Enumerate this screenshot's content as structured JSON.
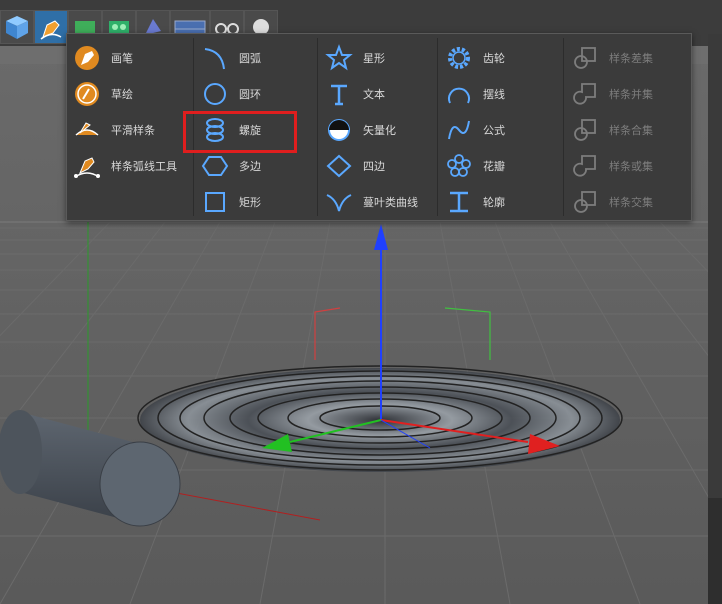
{
  "menu": {
    "col1": [
      {
        "label": "画笔",
        "icon": "pen-icon"
      },
      {
        "label": "草绘",
        "icon": "sketch-icon"
      },
      {
        "label": "平滑样条",
        "icon": "smooth-spline-icon"
      },
      {
        "label": "样条弧线工具",
        "icon": "spline-arc-tool-icon"
      }
    ],
    "col2": [
      {
        "label": "圆弧",
        "icon": "arc-icon"
      },
      {
        "label": "圆环",
        "icon": "circle-icon"
      },
      {
        "label": "螺旋",
        "icon": "helix-icon"
      },
      {
        "label": "多边",
        "icon": "polygon-icon"
      },
      {
        "label": "矩形",
        "icon": "rectangle-icon"
      }
    ],
    "col3": [
      {
        "label": "星形",
        "icon": "star-icon"
      },
      {
        "label": "文本",
        "icon": "text-icon"
      },
      {
        "label": "矢量化",
        "icon": "vectorize-icon"
      },
      {
        "label": "四边",
        "icon": "four-side-icon"
      },
      {
        "label": "蔓叶类曲线",
        "icon": "cissoid-icon"
      }
    ],
    "col4": [
      {
        "label": "齿轮",
        "icon": "gear-icon"
      },
      {
        "label": "摆线",
        "icon": "cycloid-icon"
      },
      {
        "label": "公式",
        "icon": "formula-icon"
      },
      {
        "label": "花瓣",
        "icon": "flower-icon"
      },
      {
        "label": "轮廓",
        "icon": "profile-icon"
      }
    ],
    "col5": [
      {
        "label": "样条差集",
        "icon": "spline-subtract-icon"
      },
      {
        "label": "样条并集",
        "icon": "spline-union-icon"
      },
      {
        "label": "样条合集",
        "icon": "spline-and-icon"
      },
      {
        "label": "样条或集",
        "icon": "spline-or-icon"
      },
      {
        "label": "样条交集",
        "icon": "spline-intersect-icon"
      }
    ]
  },
  "colors": {
    "accent_icon": "#5aa8ff",
    "highlight_box": "#e01e1e",
    "axis_x": "#e02020",
    "axis_y": "#22c022",
    "axis_z": "#2040ff"
  }
}
